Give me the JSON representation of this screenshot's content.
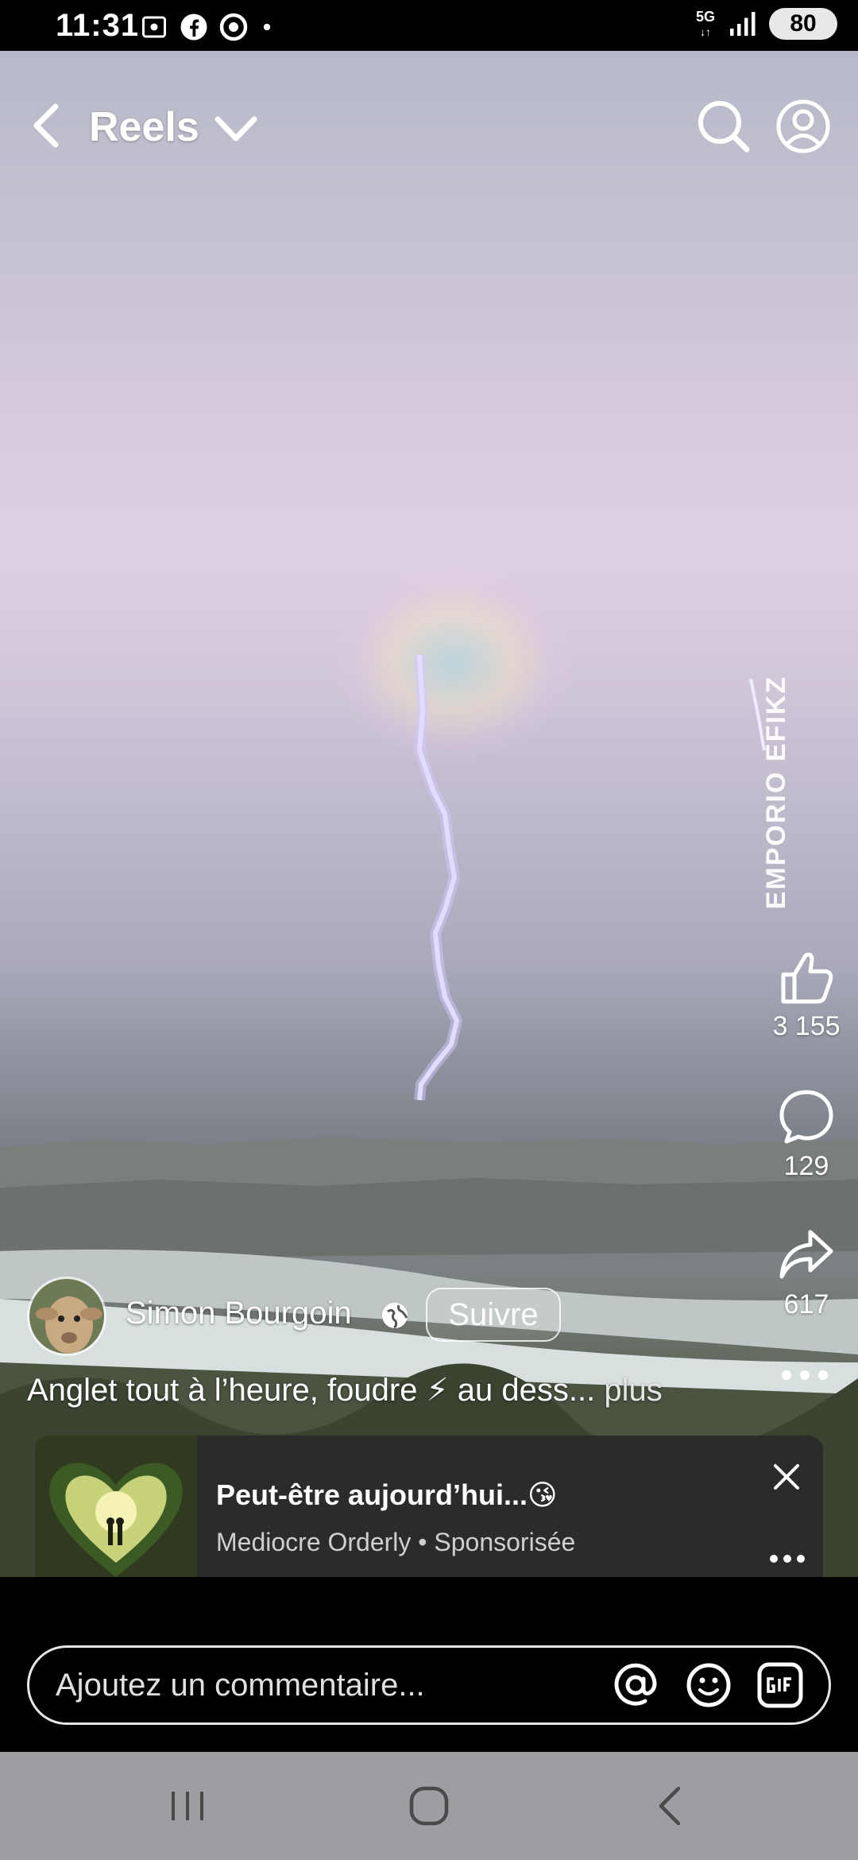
{
  "status_bar": {
    "time": "11:31",
    "network": "5G",
    "battery": "80",
    "icons": [
      "screenshot-icon",
      "facebook-icon",
      "chrome-icon",
      "dot-icon",
      "signal-icon"
    ]
  },
  "header": {
    "title": "Reels",
    "icons": [
      "back-arrow-icon",
      "chevron-down-icon",
      "search-icon",
      "profile-icon"
    ]
  },
  "video": {
    "watermark": "EMPORIO EFIKZ"
  },
  "actions": {
    "likes": "3 155",
    "comments": "129",
    "shares": "617"
  },
  "post": {
    "author": "Simon Bourgoin",
    "follow_label": "Suivre",
    "caption": "Anglet tout à l’heure, foudre ⚡ au dess...",
    "more_label": "plus"
  },
  "ad": {
    "title": "Peut-être aujourd’hui...😘",
    "advertiser": "Mediocre Orderly",
    "sponsored_label": "• Sponsorisée"
  },
  "comment_bar": {
    "placeholder": "Ajoutez un commentaire...",
    "icons": [
      "mention-icon",
      "emoji-icon",
      "gif-icon"
    ]
  },
  "colors": {
    "background": "#000000",
    "nav_bar": "#9c9ea1",
    "ad_card": "#2a2c2a"
  }
}
